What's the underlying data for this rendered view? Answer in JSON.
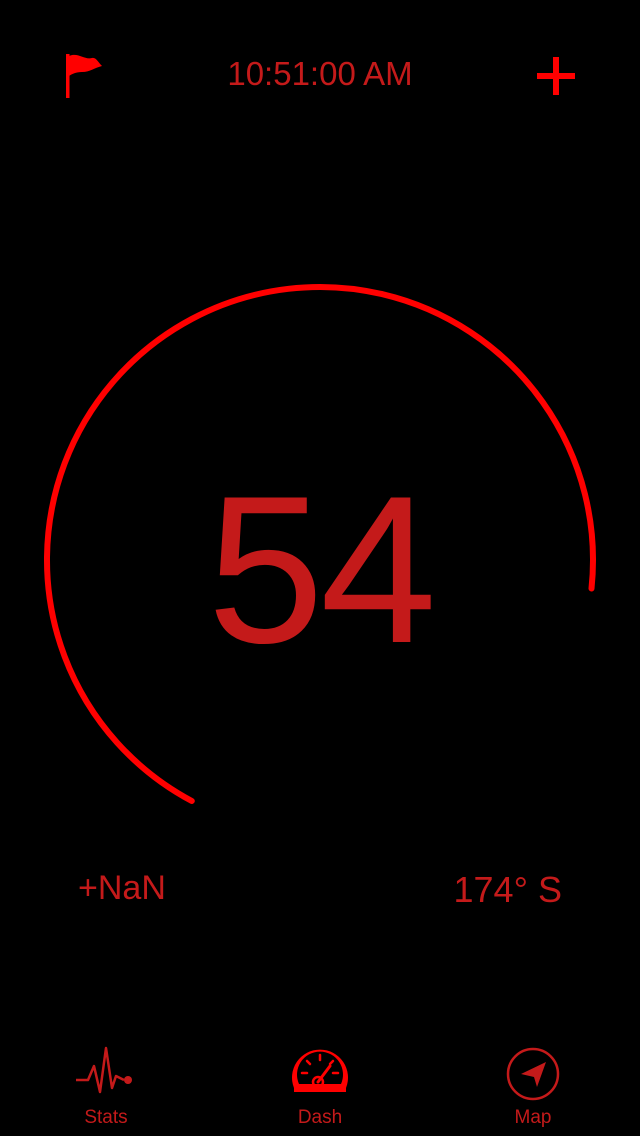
{
  "header": {
    "flag_icon": "flag-icon",
    "time": "10:51:00 AM",
    "add_icon": "plus-icon"
  },
  "gauge": {
    "speed": "54"
  },
  "readouts": {
    "altitude": "+NaN",
    "heading": "174° S"
  },
  "tabs": [
    {
      "label": "Stats",
      "icon": "pulse-icon"
    },
    {
      "label": "Dash",
      "icon": "speedometer-icon",
      "selected": true
    },
    {
      "label": "Map",
      "icon": "location-arrow-icon"
    }
  ],
  "colors": {
    "background": "#000000",
    "accent": "#ff0000",
    "text": "#c41a1a"
  }
}
